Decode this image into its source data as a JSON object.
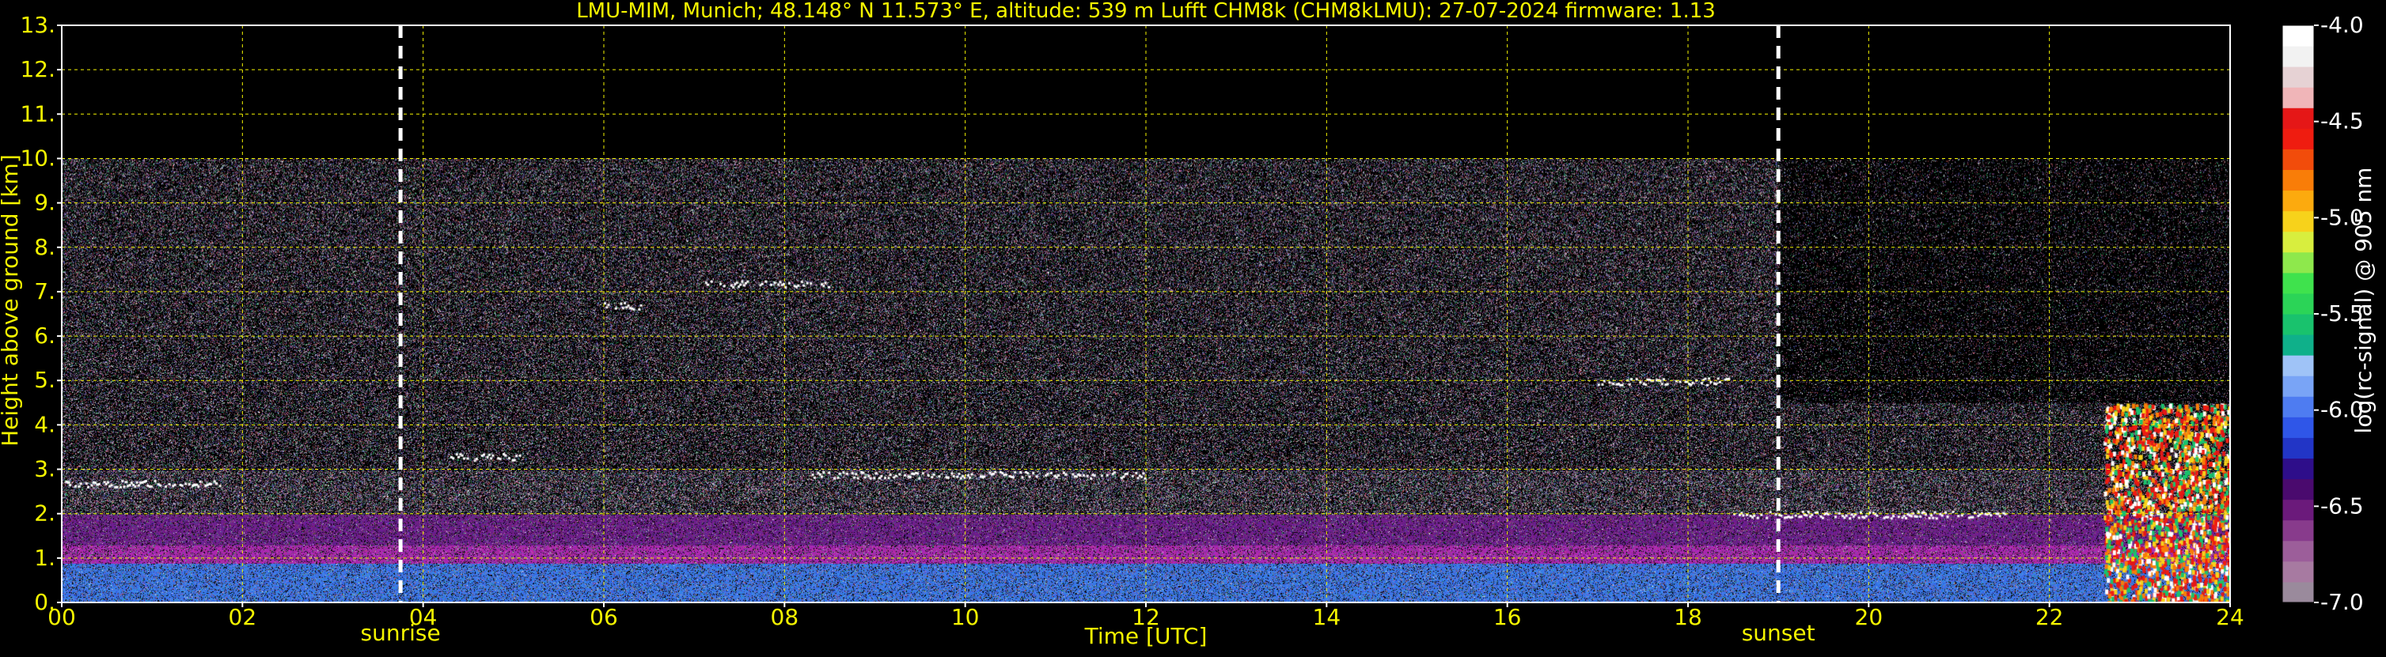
{
  "chart_data": {
    "type": "heatmap",
    "title": "LMU-MIM, Munich; 48.148° N 11.573° E, altitude: 539 m    Lufft CHM8k (CHM8kLMU): 27-07-2024    firmware: 1.13",
    "xlabel": "Time [UTC]",
    "ylabel": "Height above ground [km]",
    "x_ticks": [
      "00",
      "02",
      "04",
      "06",
      "08",
      "10",
      "12",
      "14",
      "16",
      "18",
      "20",
      "22",
      "24"
    ],
    "y_ticks": [
      "0.",
      "1.",
      "2.",
      "3.",
      "4.",
      "5.",
      "6.",
      "7.",
      "8.",
      "9.",
      "10.",
      "11.",
      "12.",
      "13."
    ],
    "xlim": [
      0,
      24
    ],
    "ylim": [
      0,
      13
    ],
    "grid": true,
    "sun_events": [
      {
        "label": "sunrise",
        "time": 3.75
      },
      {
        "label": "sunset",
        "time": 19.0
      }
    ],
    "colorbar": {
      "label": "log(rc-signal) @ 905 nm",
      "range": [
        -7.0,
        -4.0
      ],
      "ticks": [
        "-4.0",
        "-4.5",
        "-5.0",
        "-5.5",
        "-6.0",
        "-6.5",
        "-7.0"
      ],
      "colors": [
        "#9a8a9c",
        "#a77aa1",
        "#9c5e9a",
        "#883b8c",
        "#6b1a7b",
        "#4a0a6e",
        "#2e0e8a",
        "#2235c6",
        "#2f56e8",
        "#4e7cf1",
        "#79a4f6",
        "#9fc3f7",
        "#0fb08a",
        "#19c26d",
        "#2bd457",
        "#3fe24d",
        "#8ee84c",
        "#d8ee3e",
        "#f7d21b",
        "#fcaa0e",
        "#f97d08",
        "#f24c0b",
        "#ef1c10",
        "#e51717",
        "#f0b5b8",
        "#e6d2d4",
        "#f2f2f2",
        "#ffffff"
      ]
    },
    "features": [
      {
        "name": "aerosol layer",
        "t_start": 0,
        "t_end": 24,
        "h_bottom": 0,
        "h_top": 2.0
      },
      {
        "name": "cloud layer",
        "t_start": 0.0,
        "t_end": 1.8,
        "h": 2.7
      },
      {
        "name": "cloud layer",
        "t_start": 4.3,
        "t_end": 5.1,
        "h": 3.3
      },
      {
        "name": "cloud layer",
        "t_start": 6.0,
        "t_end": 6.4,
        "h": 6.7
      },
      {
        "name": "cloud layer",
        "t_start": 7.1,
        "t_end": 8.5,
        "h": 7.2
      },
      {
        "name": "cloud layer",
        "t_start": 8.3,
        "t_end": 12.0,
        "h": 2.9
      },
      {
        "name": "cloud layer",
        "t_start": 17.0,
        "t_end": 18.5,
        "h": 5.0
      },
      {
        "name": "boundary layer top",
        "t_start": 18.5,
        "t_end": 21.5,
        "h": 2.0
      },
      {
        "name": "thick cloud",
        "t_start": 22.6,
        "t_end": 24.0,
        "h_bottom": 0,
        "h_top": 4.8
      }
    ]
  }
}
